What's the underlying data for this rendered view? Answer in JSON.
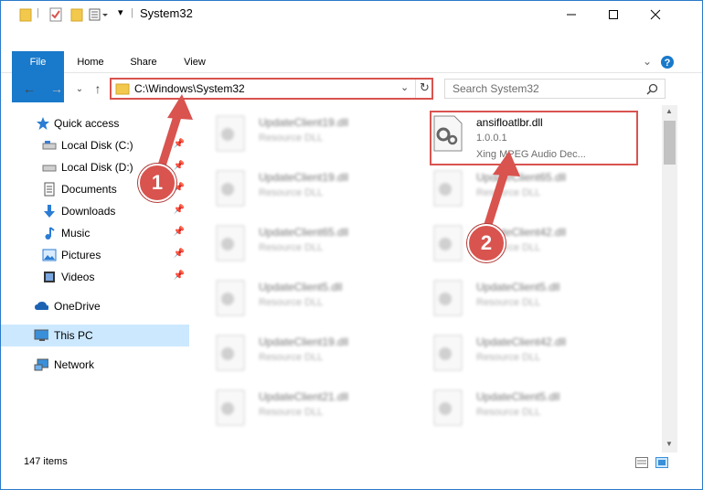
{
  "window": {
    "title": "System32"
  },
  "ribbon": {
    "tabs": [
      "File",
      "Home",
      "Share",
      "View"
    ]
  },
  "address": {
    "path": "C:\\Windows\\System32"
  },
  "search": {
    "placeholder": "Search System32"
  },
  "sidebar": {
    "items": [
      {
        "label": "Quick access",
        "icon": "star-icon",
        "pinned": false
      },
      {
        "label": "Local Disk (C:)",
        "icon": "drive-icon",
        "pinned": true
      },
      {
        "label": "Local Disk (D:)",
        "icon": "drive-icon",
        "pinned": true
      },
      {
        "label": "Documents",
        "icon": "documents-icon",
        "pinned": true
      },
      {
        "label": "Downloads",
        "icon": "downloads-icon",
        "pinned": true
      },
      {
        "label": "Music",
        "icon": "music-icon",
        "pinned": true
      },
      {
        "label": "Pictures",
        "icon": "pictures-icon",
        "pinned": true
      },
      {
        "label": "Videos",
        "icon": "videos-icon",
        "pinned": true
      },
      {
        "label": "OneDrive",
        "icon": "cloud-icon",
        "pinned": false
      },
      {
        "label": "This PC",
        "icon": "computer-icon",
        "pinned": false,
        "selected": true
      },
      {
        "label": "Network",
        "icon": "network-icon",
        "pinned": false
      }
    ]
  },
  "files": {
    "highlighted": {
      "name": "ansifloatlbr.dll",
      "version": "1.0.0.1",
      "description": "Xing MPEG Audio Dec..."
    },
    "blurred_left": [
      {
        "name": "UpdateClient19.dll",
        "type": "Resource DLL"
      },
      {
        "name": "UpdateClient19.dll",
        "type": "Resource DLL"
      },
      {
        "name": "UpdateClient65.dll",
        "type": "Resource DLL"
      },
      {
        "name": "UpdateClient5.dll",
        "type": "Resource DLL"
      },
      {
        "name": "UpdateClient19.dll",
        "type": "Resource DLL"
      },
      {
        "name": "UpdateClient21.dll",
        "type": "Resource DLL"
      }
    ],
    "blurred_right": [
      {
        "name": "UpdateClient65.dll",
        "type": "Resource DLL"
      },
      {
        "name": "UpdateClient42.dll",
        "type": "Resource DLL"
      },
      {
        "name": "UpdateClient5.dll",
        "type": "Resource DLL"
      },
      {
        "name": "UpdateClient42.dll",
        "type": "Resource DLL"
      },
      {
        "name": "UpdateClient5.dll",
        "type": "Resource DLL"
      }
    ]
  },
  "status": {
    "count": "147 items"
  },
  "callouts": [
    "1",
    "2"
  ],
  "colors": {
    "accent": "#1979ca",
    "highlight": "#d9534f",
    "selection": "#cce8ff"
  }
}
